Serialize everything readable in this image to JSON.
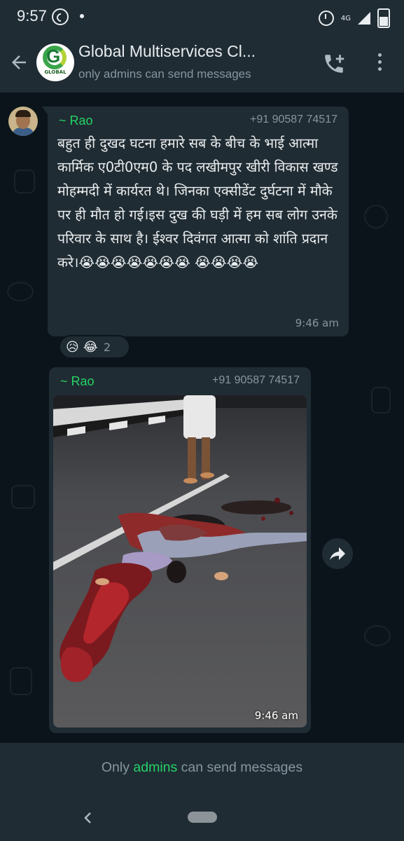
{
  "status_bar": {
    "time": "9:57",
    "network": "4G",
    "battery": "56",
    "icons": [
      "whatsapp-icon",
      "notification-dot-icon",
      "alarm-icon",
      "signal-icon",
      "battery-icon"
    ]
  },
  "header": {
    "title": "Global Multiservices Cl...",
    "subtitle": "only admins can send messages",
    "avatar_text": "GLOBAL",
    "avatar_letter": "G",
    "icons": [
      "back-arrow-icon",
      "add-call-icon",
      "more-vert-icon"
    ]
  },
  "messages": [
    {
      "sender": "~ Rao",
      "phone": "+91 90587 74517",
      "text": "बहुत ही दुखद घटना हमारे सब के बीच के भाई आत्मा कार्मिक ए0टी0एम0 के पद लखीमपुर खीरी विकास खण्ड मोहम्मदी में कार्यरत थे। जिनका एक्सीडेंट दुर्घटना में मौके पर ही मौत हो गई।इस दुख की घड़ी में हम सब लोग उनके परिवार के साथ है। ईश्वर दिवंगत आत्मा को शांति प्रदान करे।😭😭😭😭😭😭😭 😭😭😭😭",
      "time": "9:46 am",
      "reactions": {
        "emojis": [
          "😥",
          "😂"
        ],
        "count": "2"
      }
    },
    {
      "sender": "~ Rao",
      "phone": "+91 90587 74517",
      "type": "image",
      "time": "9:46 am"
    }
  ],
  "footer": {
    "prefix": "Only ",
    "link": "admins",
    "suffix": " can send messages"
  },
  "colors": {
    "background": "#0b141a",
    "bar": "#1f2c34",
    "bubble": "#202c33",
    "accent": "#25d366",
    "muted": "#8696a0"
  }
}
